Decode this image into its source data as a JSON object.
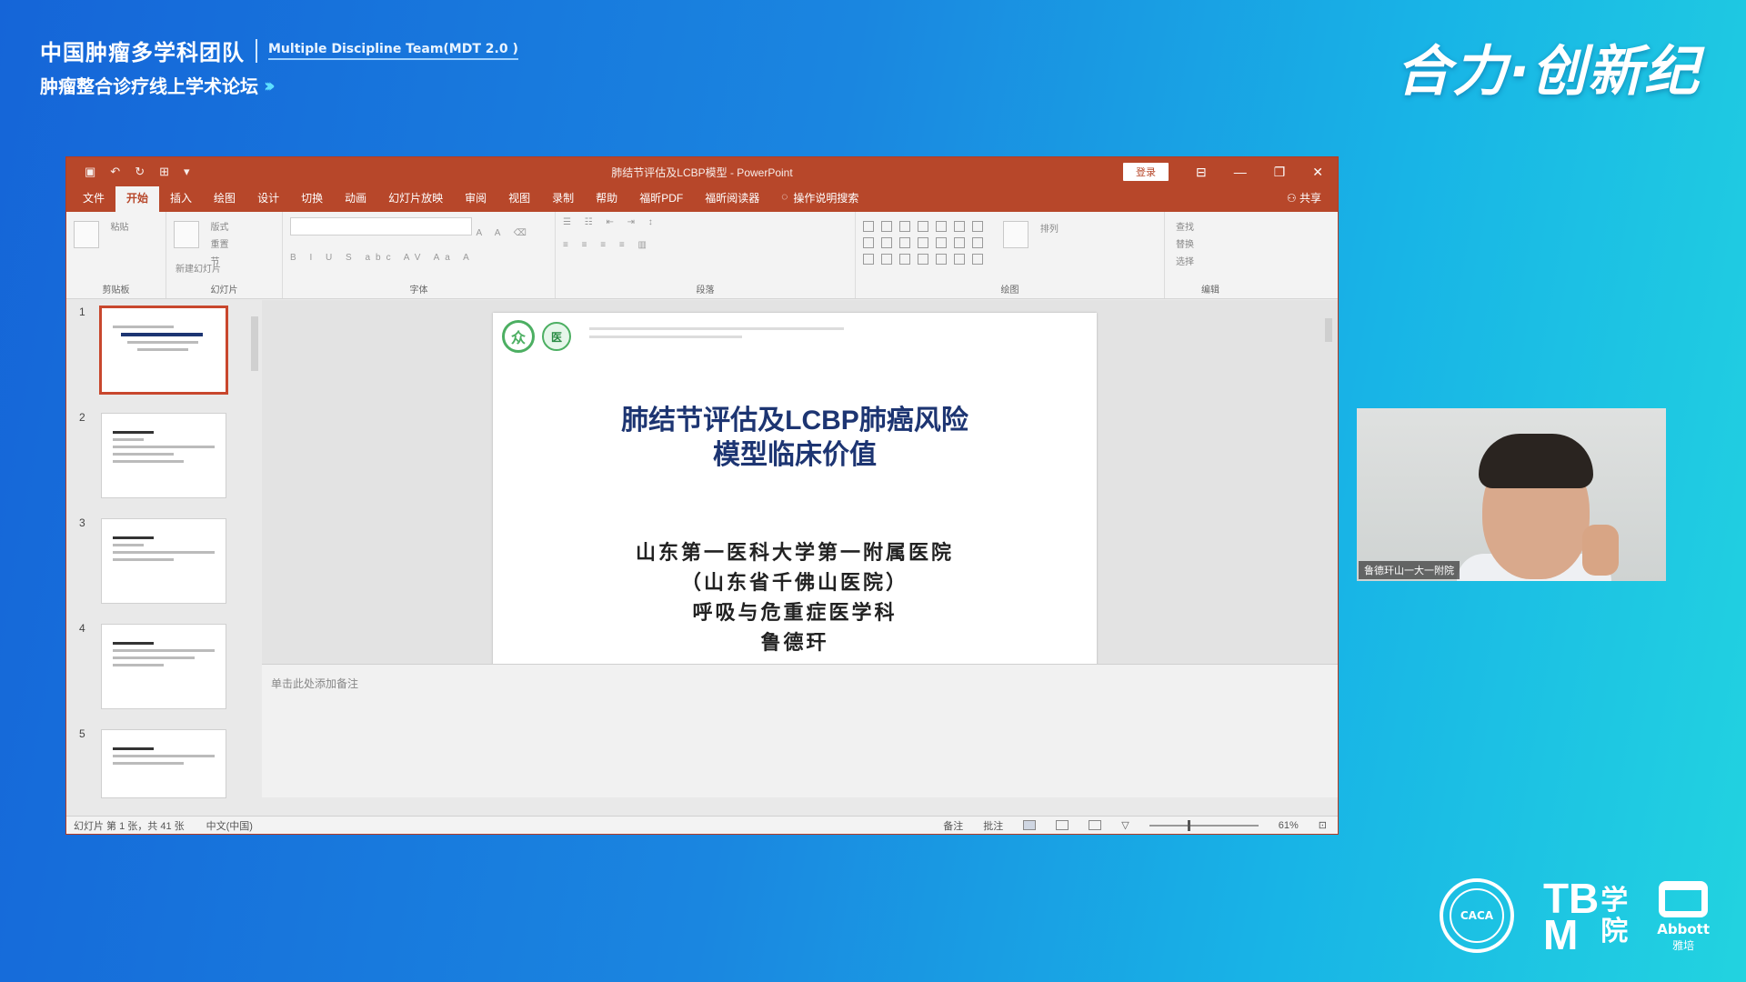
{
  "forum": {
    "title": "中国肿瘤多学科团队",
    "title_en": "Multiple Discipline Team(MDT 2.0 )",
    "subtitle": "肿瘤整合诊疗线上学术论坛",
    "slogan": "合力·创新纪"
  },
  "ppt": {
    "doc_title": "肺结节评估及LCBP模型 - PowerPoint",
    "login_label": "登录",
    "tabs": [
      "文件",
      "开始",
      "插入",
      "绘图",
      "设计",
      "切换",
      "动画",
      "幻灯片放映",
      "审阅",
      "视图",
      "录制",
      "帮助",
      "福昕PDF",
      "福昕阅读器"
    ],
    "active_tab_index": 1,
    "search_label": "操作说明搜索",
    "share_label": "共享",
    "ribbon_groups": [
      "剪贴板",
      "幻灯片",
      "字体",
      "段落",
      "绘图",
      "编辑"
    ],
    "ribbon_items": {
      "paste": "粘贴",
      "new_slide": "新建幻灯片",
      "layout": "版式",
      "reset": "重置",
      "section": "节",
      "arrange": "排列",
      "find": "查找",
      "replace": "替换",
      "select": "选择"
    },
    "thumbnails": [
      {
        "num": "1",
        "active": true
      },
      {
        "num": "2",
        "active": false
      },
      {
        "num": "3",
        "active": false
      },
      {
        "num": "4",
        "active": false
      },
      {
        "num": "5",
        "active": false
      }
    ],
    "slide": {
      "title_line1": "肺结节评估及LCBP肺癌风险",
      "title_line2": "模型临床价值",
      "body": [
        "山东第一医科大学第一附属医院",
        "（山东省千佛山医院）",
        "呼吸与危重症医学科",
        "鲁德玕"
      ],
      "logo_a": "众",
      "logo_b": "医"
    },
    "notes_placeholder": "单击此处添加备注",
    "status": {
      "slide_count": "幻灯片 第 1 张，共 41 张",
      "language": "中文(中国)",
      "notes": "备注",
      "comments": "批注",
      "zoom": "61%"
    }
  },
  "video": {
    "name_tag": "鲁德玕山一大一附院"
  },
  "logos": {
    "seal_text": "CACA",
    "tbm_left_top": "TB",
    "tbm_left_bottom": "M",
    "tbm_right_top": "学",
    "tbm_right_bottom": "院",
    "abbott_name": "Abbott",
    "abbott_cn": "雅培"
  }
}
